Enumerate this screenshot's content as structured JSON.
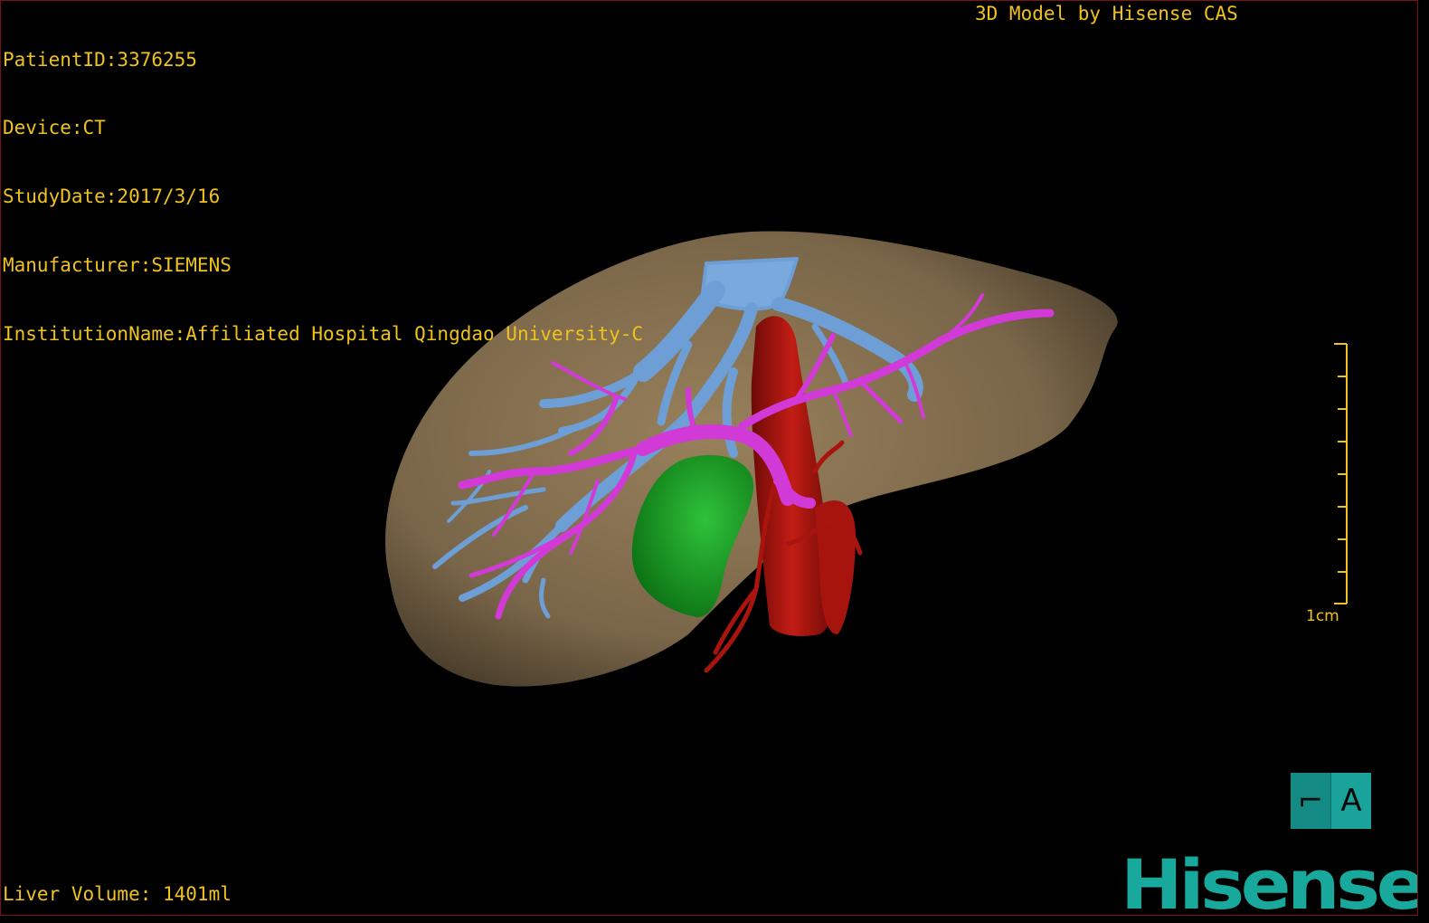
{
  "overlay": {
    "patient_id": "PatientID:3376255",
    "device": "Device:CT",
    "study_date": "StudyDate:2017/3/16",
    "manufacturer": "Manufacturer:SIEMENS",
    "institution": "InstitutionName:Affiliated Hospital Qingdao University-C",
    "model_caption": "3D Model by Hisense CAS",
    "liver_volume": "Liver Volume: 1401ml"
  },
  "scale_bar": {
    "label": "1cm"
  },
  "toolbar": {
    "two_d_glyph": "⌐",
    "three_d_label": "A"
  },
  "brand": {
    "logo_text": "Hisense"
  },
  "colors": {
    "overlay_text": "#f0c21e",
    "liver": "#8a7254",
    "hepatic_vein": "#6d9fd6",
    "portal_vein": "#d23ad8",
    "artery": "#b0170f",
    "gallbladder": "#138f18",
    "brand": "#18a89c"
  }
}
